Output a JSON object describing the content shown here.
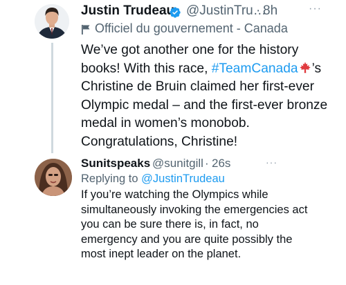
{
  "tweet1": {
    "author_name": "Justin Trudeau",
    "author_handle": "@JustinTru…",
    "separator": "·",
    "time": "8h",
    "more": "···",
    "gov_label": "Officiel du gouvernement - Canada",
    "text_line1": "We’ve got another one for the history books! With this race, ",
    "hashtag": "#TeamCanada",
    "text_line2": "’s Christine de Bruin claimed her first-ever Olympic medal – and the first-ever bronze medal in women’s monobob. Congratulations, Christine!",
    "verified_icon": "verified-badge-icon",
    "flag_icon": "flag-icon",
    "emoji_icon": "maple-leaf-emoji"
  },
  "tweet2": {
    "author_name": "Sunitspeaks",
    "author_handle": "@sunitgill",
    "separator": "·",
    "time": "26s",
    "more": "···",
    "replying_prefix": "Replying to ",
    "replying_handle": "@JustinTrudeau",
    "text": "If you’re watching the Olympics while simultaneously invoking the emergencies act you can be sure there is, in fact, no emergency and you are quite possibly the most inept leader on the planet."
  },
  "colors": {
    "link": "#1d9bf0",
    "secondary_text": "#536471",
    "thread_line": "#cfd9de"
  }
}
